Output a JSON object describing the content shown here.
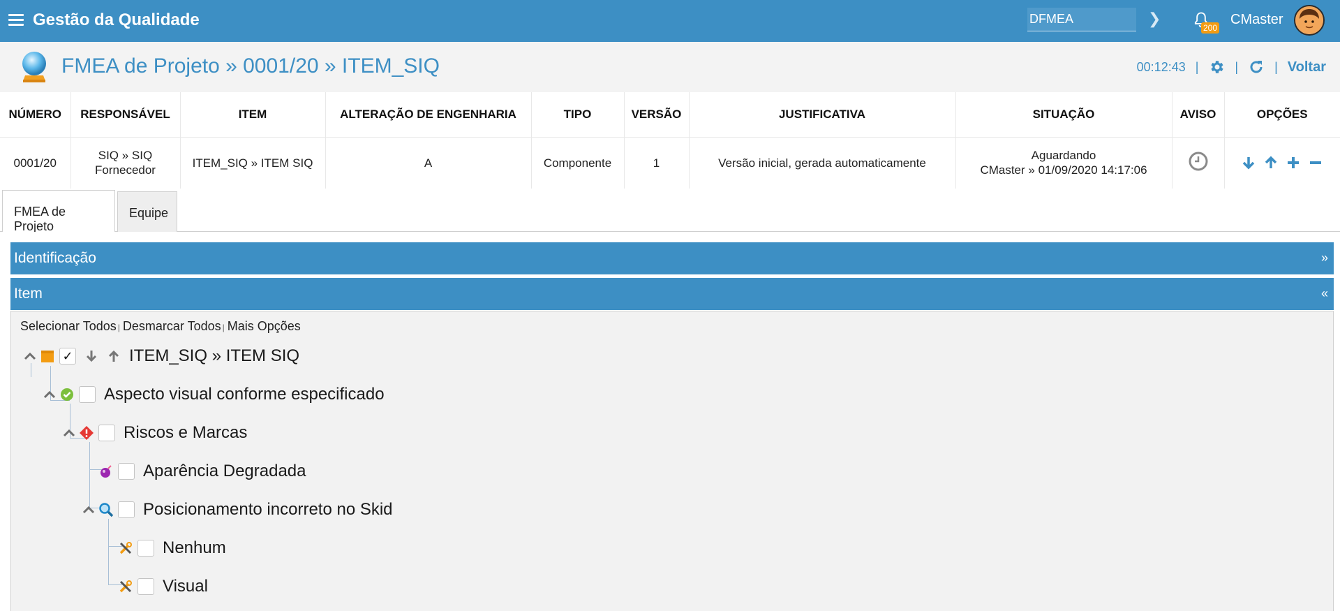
{
  "topbar": {
    "app_title": "Gestão da Qualidade",
    "search_value": "DFMEA",
    "notification_count": "200",
    "user_name": "CMaster"
  },
  "page": {
    "title": "FMEA de Projeto » 0001/20 » ITEM_SIQ",
    "timer": "00:12:43",
    "back_label": "Voltar"
  },
  "info_table": {
    "headers": [
      "NÚMERO",
      "RESPONSÁVEL",
      "ITEM",
      "ALTERAÇÃO DE ENGENHARIA",
      "TIPO",
      "VERSÃO",
      "JUSTIFICATIVA",
      "SITUAÇÃO",
      "AVISO",
      "OPÇÕES"
    ],
    "row": {
      "numero": "0001/20",
      "responsavel_line1": "SIQ » SIQ",
      "responsavel_line2": "Fornecedor",
      "item": "ITEM_SIQ » ITEM SIQ",
      "alteracao": "A",
      "tipo": "Componente",
      "versao": "1",
      "justificativa": "Versão inicial, gerada automaticamente",
      "situacao_line1": "Aguardando",
      "situacao_line2": "CMaster » 01/09/2020 14:17:06"
    }
  },
  "tabs": [
    {
      "label": "FMEA de Projeto",
      "active": true
    },
    {
      "label": "Equipe",
      "active": false
    }
  ],
  "panels": {
    "identificacao": {
      "label": "Identificação",
      "toggle": "»"
    },
    "item": {
      "label": "Item",
      "toggle": "«"
    }
  },
  "select_links": {
    "select_all": "Selecionar Todos",
    "deselect_all": "Desmarcar Todos",
    "more_options": "Mais Opções"
  },
  "tree": [
    {
      "label": "ITEM_SIQ » ITEM SIQ",
      "icon": "item-box-icon",
      "checked": true
    },
    {
      "label": "Aspecto visual conforme especificado",
      "icon": "function-check-icon",
      "checked": false
    },
    {
      "label": "Riscos e Marcas",
      "icon": "failure-mode-icon",
      "checked": false
    },
    {
      "label": "Aparência Degradada",
      "icon": "effect-icon",
      "checked": false
    },
    {
      "label": "Posicionamento incorreto no Skid",
      "icon": "cause-search-icon",
      "checked": false
    },
    {
      "label": "Nenhum",
      "icon": "control-tools-icon",
      "checked": false
    },
    {
      "label": "Visual",
      "icon": "control-tools-icon",
      "checked": false
    }
  ],
  "colors": {
    "brand_blue": "#3d8fc4",
    "badge_orange": "#f39c12"
  }
}
